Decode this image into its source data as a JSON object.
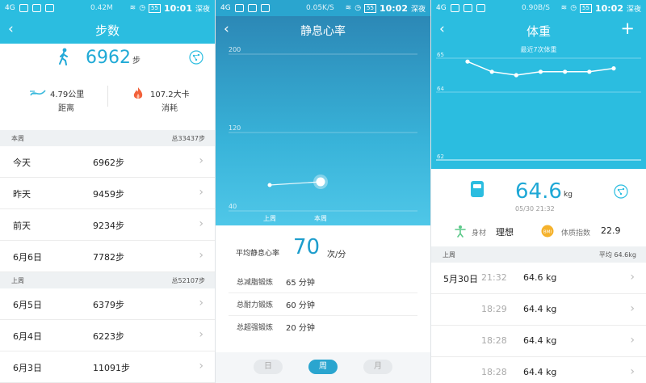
{
  "status_bars": [
    {
      "net": "0.42M",
      "time": "10:01",
      "mode": "深夜",
      "signal": "4G",
      "battery": "55"
    },
    {
      "net": "0.05K/S",
      "time": "10:02",
      "mode": "深夜",
      "signal": "4G",
      "battery": "55"
    },
    {
      "net": "0.90B/S",
      "time": "10:02",
      "mode": "深夜",
      "signal": "4G",
      "battery": "55"
    }
  ],
  "steps_screen": {
    "title": "步数",
    "back": "‹",
    "steps_value": "6962",
    "steps_unit": "步",
    "distance_value": "4.79公里",
    "distance_label": "距离",
    "calories_value": "107.2大卡",
    "calories_label": "消耗",
    "this_week": {
      "label": "本周",
      "total": "总33437步"
    },
    "this_week_rows": [
      {
        "day": "今天",
        "steps": "6962步"
      },
      {
        "day": "昨天",
        "steps": "9459步"
      },
      {
        "day": "前天",
        "steps": "9234步"
      },
      {
        "day": "6月6日",
        "steps": "7782步"
      }
    ],
    "last_week": {
      "label": "上周",
      "total": "总52107步"
    },
    "last_week_rows": [
      {
        "day": "6月5日",
        "steps": "6379步"
      },
      {
        "day": "6月4日",
        "steps": "6223步"
      },
      {
        "day": "6月3日",
        "steps": "11091步"
      }
    ],
    "chevron": "›"
  },
  "heart_rate_screen": {
    "title": "静息心率",
    "back": "‹",
    "y_ticks": [
      "200",
      "120",
      "40"
    ],
    "x_labels": [
      "上周",
      "本周"
    ],
    "avg_label": "平均静息心率",
    "avg_value": "70",
    "avg_unit": "次/分",
    "workouts": [
      {
        "label": "总减脂锻炼",
        "value": "65 分钟"
      },
      {
        "label": "总耐力锻炼",
        "value": "60 分钟"
      },
      {
        "label": "总超强锻炼",
        "value": "20 分钟"
      }
    ],
    "tabs": [
      {
        "label": "日",
        "active": false
      },
      {
        "label": "周",
        "active": true
      },
      {
        "label": "月",
        "active": false
      }
    ]
  },
  "weight_screen": {
    "title": "体重",
    "back": "‹",
    "add": "+",
    "subtitle": "最近7次体重",
    "y_ticks": [
      "65",
      "64",
      "62"
    ],
    "weight_value": "64.6",
    "weight_unit": "kg",
    "weight_date": "05/30 21:32",
    "body_label": "身材",
    "body_value": "理想",
    "bmi_label": "体质指数",
    "bmi_value": "22.9",
    "bmi_badge": "BMI",
    "section_label": "上周",
    "section_avg": "平均 64.6kg",
    "records": [
      {
        "date": "5月30日",
        "time": "21:32",
        "weight": "64.6 kg"
      },
      {
        "date": "",
        "time": "18:29",
        "weight": "64.4 kg"
      },
      {
        "date": "",
        "time": "18:28",
        "weight": "64.4 kg"
      },
      {
        "date": "",
        "time": "18:28",
        "weight": "64.4 kg"
      }
    ],
    "chevron": "›"
  },
  "chart_data": [
    {
      "type": "line",
      "x": [
        "上周",
        "本周"
      ],
      "values": [
        null,
        null
      ],
      "xlabel": "",
      "ylabel": "",
      "ylim": [
        40,
        200
      ],
      "y_ticks": [
        40,
        120,
        200
      ],
      "grid": true
    },
    {
      "type": "line",
      "title": "最近7次体重",
      "values": [
        64.9,
        64.6,
        64.5,
        64.6,
        64.6,
        64.6,
        64.7
      ],
      "ylim": [
        62,
        65
      ],
      "y_ticks": [
        62,
        64,
        65
      ],
      "grid": true
    }
  ],
  "colors": {
    "primary": "#2bbde0",
    "accent_text": "#20aad6",
    "hr_gradient_top": "#2c88b6",
    "fire": "#f2613a",
    "bmi_badge": "#f5b22c",
    "body_icon": "#5cc98a"
  }
}
